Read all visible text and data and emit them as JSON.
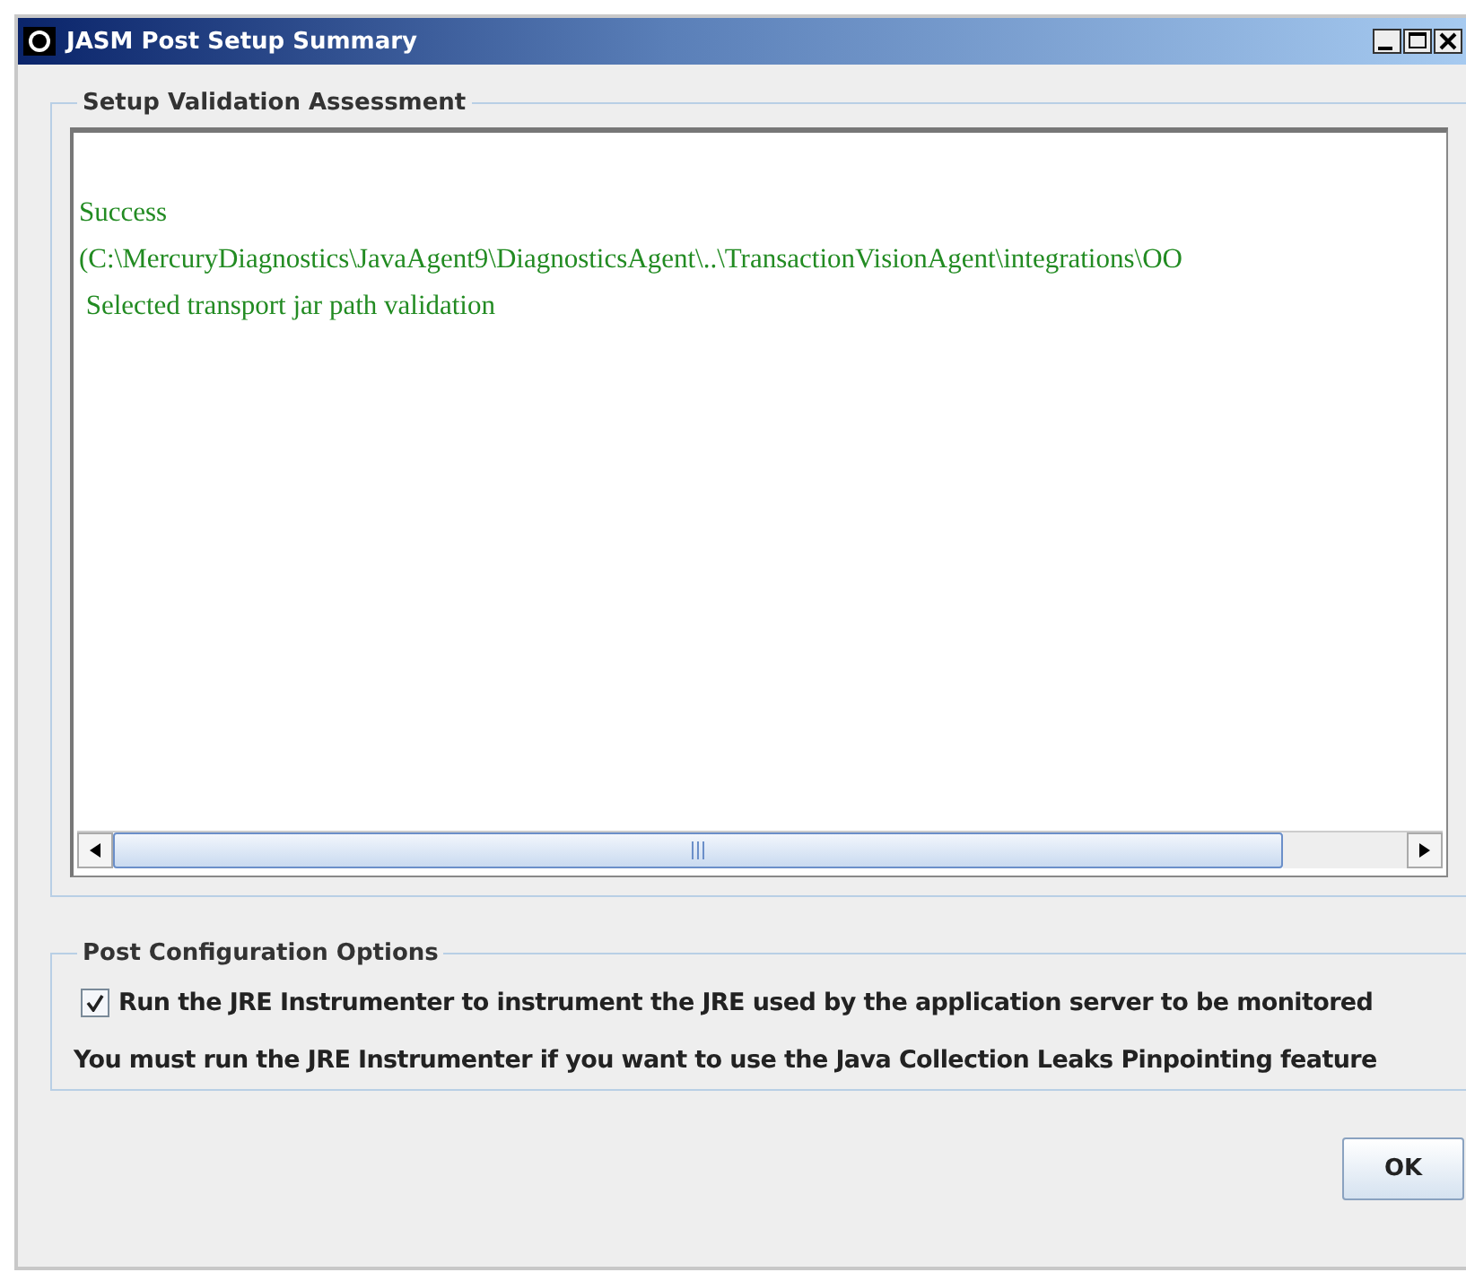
{
  "window": {
    "title": "JASM Post Setup Summary"
  },
  "validation": {
    "title": "Setup Validation Assessment",
    "lines": [
      "Success",
      "(C:\\MercuryDiagnostics\\JavaAgent9\\DiagnosticsAgent\\..\\TransactionVisionAgent\\integrations\\OO",
      " Selected transport jar path validation"
    ]
  },
  "options": {
    "title": "Post Configuration Options",
    "checkbox": {
      "label": "Run the JRE Instrumenter to instrument the JRE used by the application server to be monitored",
      "checked": true
    },
    "note": "You must run the JRE Instrumenter if you want to use the Java Collection Leaks Pinpointing feature"
  },
  "buttons": [
    "OK"
  ]
}
